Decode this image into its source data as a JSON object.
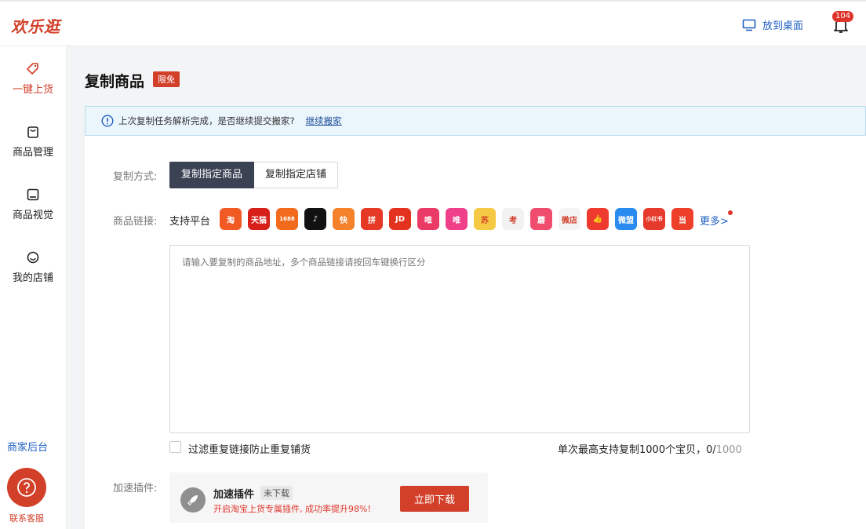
{
  "app": {
    "logo": "欢乐逛"
  },
  "header": {
    "desktop_label": "放到桌面",
    "notification_count": "104"
  },
  "sidebar": {
    "items": [
      {
        "label": "一键上货",
        "icon": "tag-icon",
        "active": true
      },
      {
        "label": "商品管理",
        "icon": "bag-icon",
        "active": false
      },
      {
        "label": "商品视觉",
        "icon": "image-icon",
        "active": false
      },
      {
        "label": "我的店铺",
        "icon": "shop-icon",
        "active": false
      }
    ],
    "merchant_label": "商家后台",
    "help_label": "联系客服"
  },
  "page": {
    "title": "复制商品",
    "badge": "限免"
  },
  "notice": {
    "text": "上次复制任务解析完成，是否继续提交搬家?",
    "link": "继续搬家"
  },
  "form": {
    "mode_label": "复制方式:",
    "mode_options": [
      "复制指定商品",
      "复制指定店铺"
    ],
    "link_label": "商品链接:",
    "platform_label": "支持平台",
    "platforms": [
      {
        "name": "taobao-icon",
        "text": "淘",
        "color": "#f25a24"
      },
      {
        "name": "tmall-icon",
        "text": "天猫",
        "color": "#d8201b"
      },
      {
        "name": "1688-icon",
        "text": "1688",
        "color": "#f26b1d"
      },
      {
        "name": "douyin-icon",
        "text": "♪",
        "color": "#111111"
      },
      {
        "name": "kuaishou-icon",
        "text": "快",
        "color": "#f5812a"
      },
      {
        "name": "pinduoduo-icon",
        "text": "拼",
        "color": "#e63926"
      },
      {
        "name": "jd-icon",
        "text": "JD",
        "color": "#e3321e"
      },
      {
        "name": "vipshop-icon",
        "text": "唯",
        "color": "#ea3b66"
      },
      {
        "name": "wei-icon",
        "text": "唯",
        "color": "#f0408a"
      },
      {
        "name": "suning-icon",
        "text": "苏",
        "color": "#f6c944"
      },
      {
        "name": "kaola-icon",
        "text": "考",
        "color": "#f2f2f2"
      },
      {
        "name": "mogujie-icon",
        "text": "蘑",
        "color": "#f04c6e"
      },
      {
        "name": "weidian-icon",
        "text": "微店",
        "color": "#f4f4f4"
      },
      {
        "name": "dianzan-icon",
        "text": "👍",
        "color": "#ee3a2f"
      },
      {
        "name": "weimeng-icon",
        "text": "微盟",
        "color": "#2a8cf0"
      },
      {
        "name": "xiaohongshu-icon",
        "text": "小红书",
        "color": "#e63a2c"
      },
      {
        "name": "dangdang-icon",
        "text": "当",
        "color": "#ee3f2a"
      }
    ],
    "more_label": "更多>",
    "textarea_placeholder": "请输入要复制的商品地址，多个商品链接请按回车键换行区分",
    "filter_label": "过滤重复链接防止重复铺货",
    "counter_prefix": "单次最高支持复制1000个宝贝，0/",
    "counter_max": "1000",
    "plugin_label": "加速插件:",
    "plugin": {
      "name": "加速插件",
      "status": "未下载",
      "desc": "开启淘宝上货专属插件, 成功率提升98%!",
      "button": "立即下载"
    }
  }
}
